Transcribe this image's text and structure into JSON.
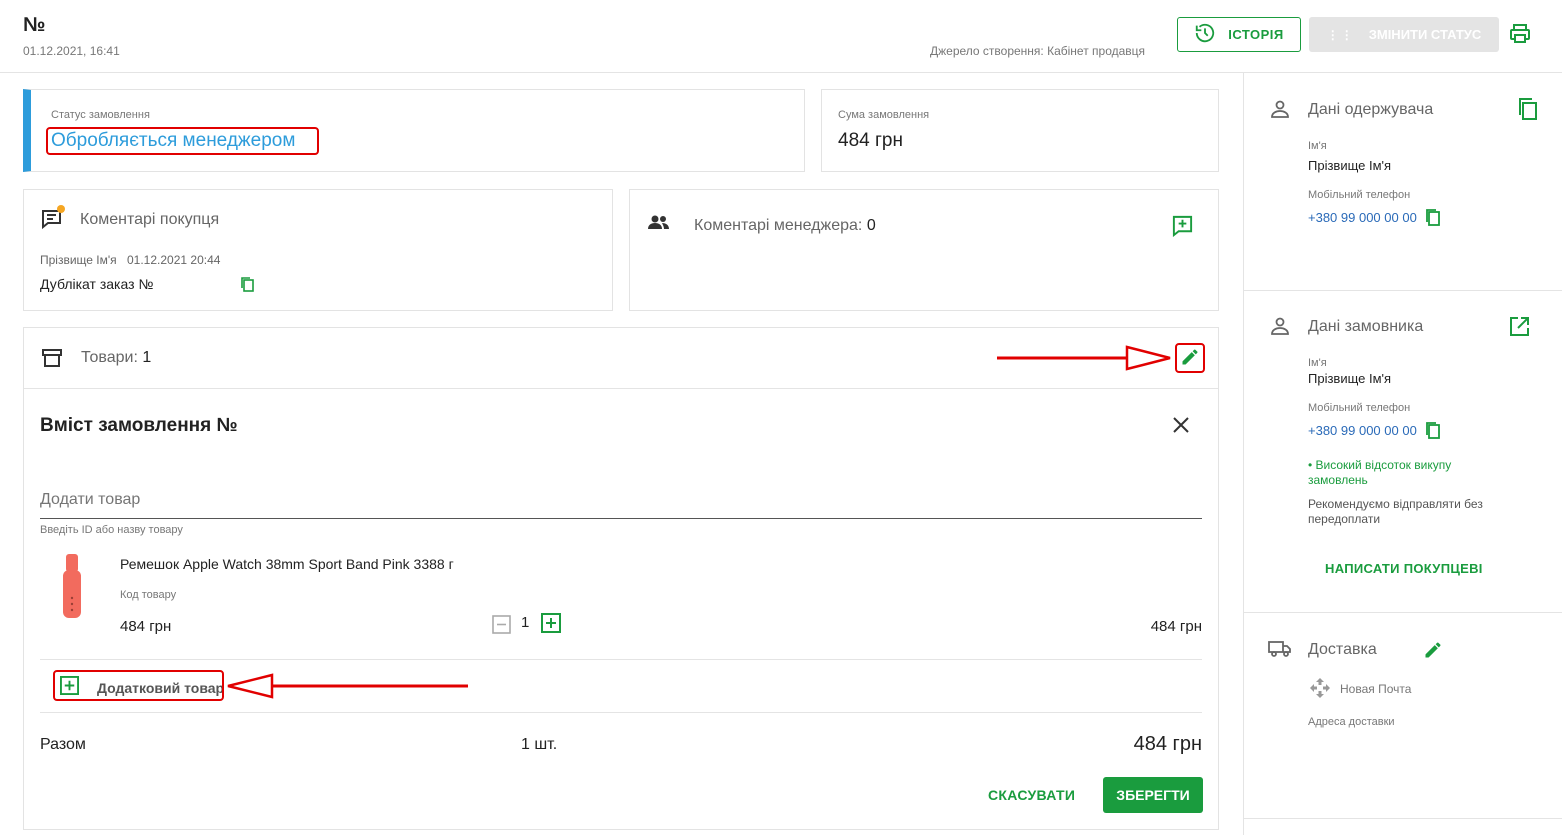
{
  "header": {
    "order_no": "№",
    "datetime": "01.12.2021, 16:41",
    "source": "Джерело створення: Кабінет продавця",
    "history_label": "ІСТОРІЯ",
    "change_status_label": "ЗМІНИТИ СТАТУС"
  },
  "status": {
    "label": "Статус замовлення",
    "value": "Обробляється менеджером"
  },
  "sum": {
    "label": "Сума замовлення",
    "value": "484 грн"
  },
  "buyer_comments": {
    "title": "Коментарі покупця",
    "author": "Прізвище Ім'я",
    "date": "01.12.2021 20:44",
    "text": "Дублікат заказ №"
  },
  "manager_comments": {
    "title": "Коментарі менеджера:",
    "count": "0"
  },
  "goods": {
    "title": "Товари:",
    "count": "1"
  },
  "order_content": {
    "title": "Вміст замовлення №",
    "add_placeholder": "Додати товар",
    "add_hint": "Введіть ID або назву товару",
    "product": {
      "name": "Ремешок Apple Watch 38mm Sport Band Pink 3388 г",
      "code_label": "Код товару",
      "price": "484 грн",
      "qty": "1",
      "total": "484 грн"
    },
    "extra_item_label": "Додатковий товар",
    "total_label": "Разом",
    "total_qty": "1 шт.",
    "total_sum": "484 грн",
    "cancel_label": "СКАСУВАТИ",
    "save_label": "ЗБЕРЕГТИ"
  },
  "recipient": {
    "title": "Дані одержувача",
    "name_label": "Ім'я",
    "name": "Прізвище Ім'я",
    "phone_label": "Мобільний телефон",
    "phone": "+380 99 000 00 00"
  },
  "customer": {
    "title": "Дані замовника",
    "name_label": "Ім'я",
    "name": "Прізвище Ім'я",
    "phone_label": "Мобільний телефон",
    "phone": "+380 99 000 00 00",
    "badge": "• Високий відсоток викупу замовлень",
    "recommendation": "Рекомендуємо відправляти без передоплати",
    "write_label": "НАПИСАТИ ПОКУПЦЕВІ"
  },
  "delivery": {
    "title": "Доставка",
    "carrier": "Новая Почта",
    "address_label": "Адреса доставки"
  },
  "colors": {
    "accent": "#1a9c3e",
    "status_blue": "#2d9cdb",
    "annotation_red": "#e10000"
  }
}
